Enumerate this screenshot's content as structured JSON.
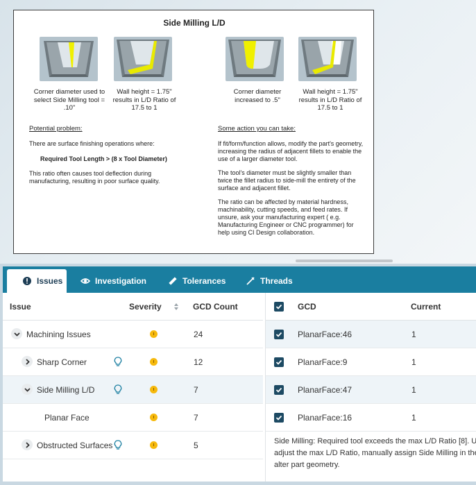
{
  "help_card": {
    "title": "Side Milling L/D",
    "captions": [
      "Corner diameter used to select Side Milling tool = .10\"",
      "Wall height = 1.75\" results in L/D Ratio of 17.5 to 1",
      "Corner diameter increased to .5\"",
      "Wall height = 1.75\" results in L/D Ratio of 17.5 to 1"
    ],
    "problem_heading": "Potential problem:",
    "problem_intro": "There are surface finishing operations where:",
    "problem_formula": "Required Tool Length > (8 x Tool Diameter)",
    "problem_text_1": "This ratio often causes tool deflection during",
    "problem_text_2": "manufacturing, resulting in poor surface quality.",
    "action_heading": "Some action you can take:",
    "action_p1": [
      "If fit/form/function allows, modify the part's geometry,",
      "increasing the radius of adjacent fillets to enable the",
      "use of a larger diameter tool."
    ],
    "action_p2": [
      "The tool's diameter must be slightly smaller than",
      "twice the fillet radius to side-mill the entirety of the",
      "surface and adjacent fillet."
    ],
    "action_p3": [
      "The ratio can be affected by material hardness,",
      "machinability, cutting speeds, and feed rates. If",
      "unsure, ask your manufacturing expert ( e.g.",
      "Manufacturing Engineer or CNC programmer) for",
      "help using CI Design collaboration."
    ]
  },
  "tabs": [
    {
      "label": "Issues",
      "icon": "alert-circle-icon",
      "active": true
    },
    {
      "label": "Investigation",
      "icon": "eye-icon",
      "active": false
    },
    {
      "label": "Tolerances",
      "icon": "ruler-icon",
      "active": false
    },
    {
      "label": "Threads",
      "icon": "thread-icon",
      "active": false
    }
  ],
  "issues_table": {
    "columns": [
      "Issue",
      "Severity",
      "GCD Count"
    ],
    "rows": [
      {
        "name": "Machining Issues",
        "count": "24",
        "expanded": true,
        "level": 0
      },
      {
        "name": "Sharp Corner",
        "count": "12",
        "expanded": false,
        "level": 1
      },
      {
        "name": "Side Milling L/D",
        "count": "7",
        "expanded": true,
        "level": 1,
        "selected": true
      },
      {
        "name": "Planar Face",
        "count": "7",
        "level": 2
      },
      {
        "name": "Obstructed Surfaces",
        "count": "5",
        "expanded": false,
        "level": 1
      }
    ]
  },
  "gcd_table": {
    "columns": [
      "GCD",
      "Current"
    ],
    "rows": [
      {
        "gcd": "PlanarFace:46",
        "current": "1"
      },
      {
        "gcd": "PlanarFace:9",
        "current": "1"
      },
      {
        "gcd": "PlanarFace:47",
        "current": "1"
      },
      {
        "gcd": "PlanarFace:16",
        "current": "1"
      }
    ],
    "description": [
      "Side Milling: Required tool exceeds the max L/D Ratio [8]. U",
      "adjust the max L/D Ratio, manually assign Side Milling in the",
      "alter part geometry."
    ]
  },
  "colors": {
    "tab_bar": "#1a7ea0",
    "severity_warning": "#f6b90c",
    "checkbox": "#1d4a63",
    "highlight_yellow": "#f0f000"
  }
}
